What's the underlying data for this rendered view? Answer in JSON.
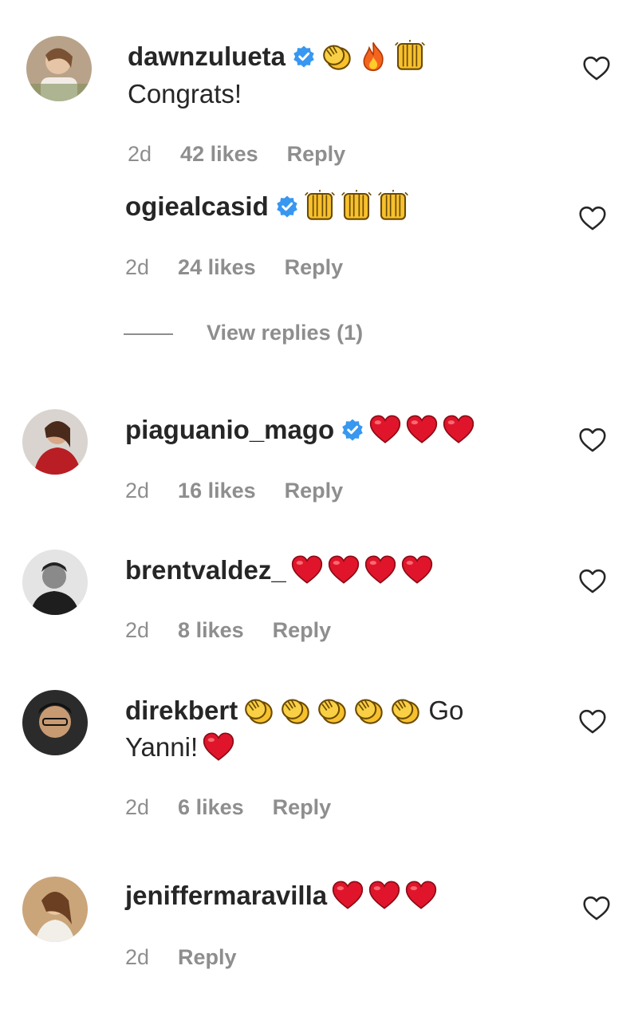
{
  "comments": [
    {
      "user": "dawnzulueta",
      "verified": true,
      "text": "Congrats!",
      "time": "2d",
      "likes": "42 likes",
      "reply": "Reply",
      "emojis": [
        "clap-emoji",
        "fire-emoji",
        "raised-hands-emoji"
      ]
    },
    {
      "user": "ogiealcasid",
      "verified": true,
      "text": "",
      "time": "2d",
      "likes": "24 likes",
      "reply": "Reply",
      "emojis": [
        "raised-hands-emoji",
        "raised-hands-emoji",
        "raised-hands-emoji"
      ]
    },
    {
      "user": "piaguanio_mago",
      "verified": true,
      "text": "",
      "time": "2d",
      "likes": "16 likes",
      "reply": "Reply",
      "emojis": [
        "red-heart-emoji",
        "red-heart-emoji",
        "red-heart-emoji"
      ]
    },
    {
      "user": "brentvaldez_",
      "verified": false,
      "text": "",
      "time": "2d",
      "likes": "8 likes",
      "reply": "Reply",
      "emojis": [
        "red-heart-emoji",
        "red-heart-emoji",
        "red-heart-emoji",
        "red-heart-emoji"
      ]
    },
    {
      "user": "direkbert",
      "verified": false,
      "text_part1": "Go",
      "text_part2": "Yanni!",
      "time": "2d",
      "likes": "6 likes",
      "reply": "Reply",
      "emojis": [
        "clap-emoji",
        "clap-emoji",
        "clap-emoji",
        "clap-emoji",
        "clap-emoji"
      ],
      "emojis_after": [
        "red-heart-emoji"
      ]
    },
    {
      "user": "jeniffermaravilla",
      "verified": false,
      "text": "",
      "time": "2d",
      "likes": "",
      "reply": "Reply",
      "emojis": [
        "red-heart-emoji",
        "red-heart-emoji",
        "red-heart-emoji"
      ]
    }
  ],
  "view_replies": "View replies (1)",
  "colors": {
    "verified": "#3897f0",
    "meta": "#8e8e8e",
    "heart_emoji": "#e0152b",
    "clap": "#f7c12e"
  }
}
